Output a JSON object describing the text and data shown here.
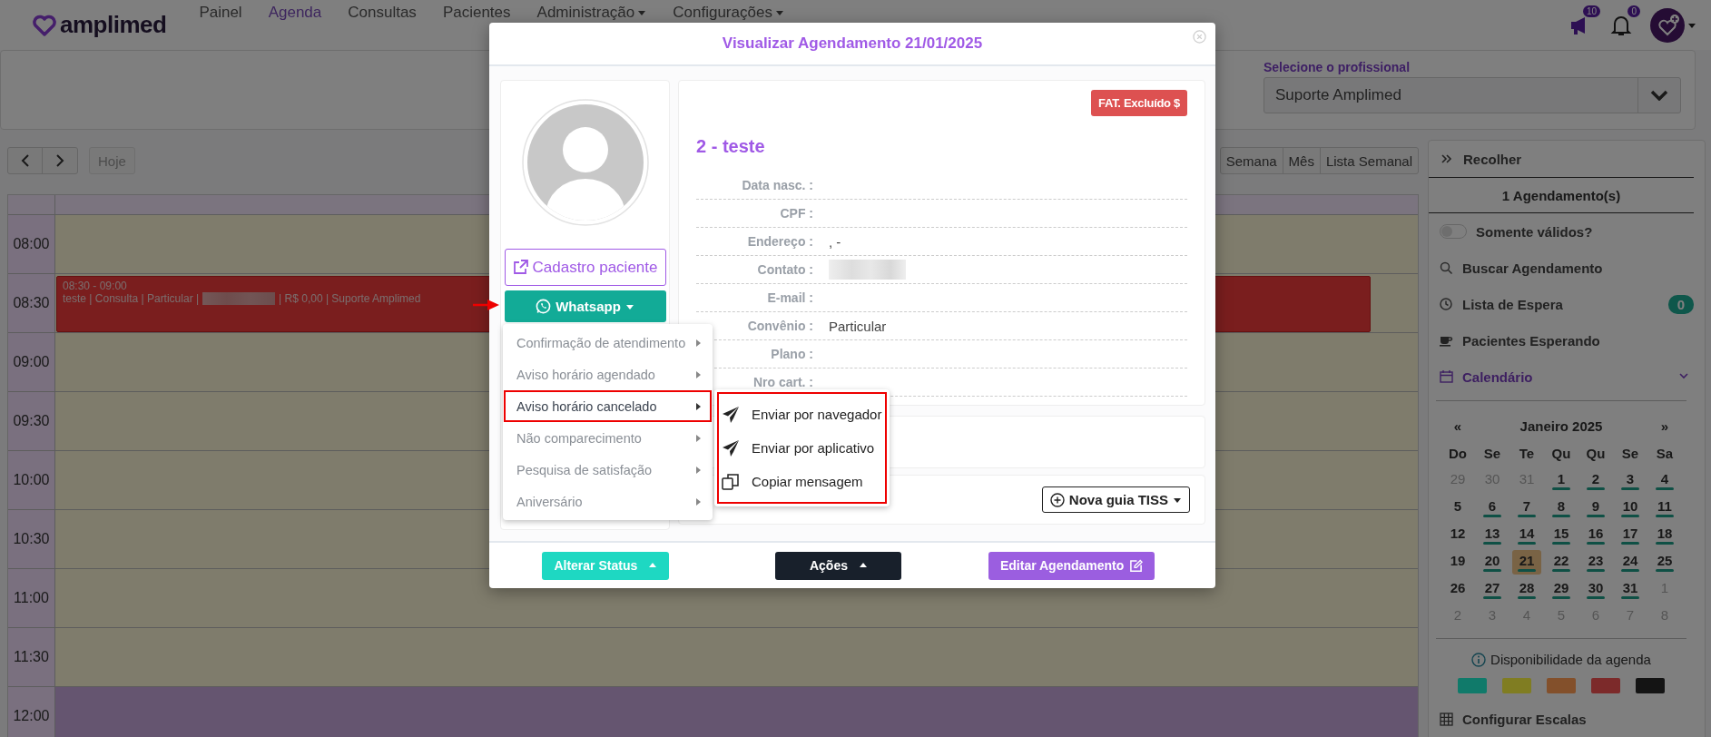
{
  "nav": {
    "logo": "amplimed",
    "items": [
      {
        "label": "Painel",
        "selected": false,
        "dropdown": false
      },
      {
        "label": "Agenda",
        "selected": true,
        "dropdown": false
      },
      {
        "label": "Consultas",
        "selected": false,
        "dropdown": false
      },
      {
        "label": "Pacientes",
        "selected": false,
        "dropdown": false
      },
      {
        "label": "Administração",
        "selected": false,
        "dropdown": true
      },
      {
        "label": "Configurações",
        "selected": false,
        "dropdown": true
      }
    ],
    "announcements_badge": "10",
    "notifications_badge": "0"
  },
  "header": {
    "professional_label": "Selecione o profissional",
    "professional_value": "Suporte Amplimed"
  },
  "toolbar": {
    "today": "Hoje",
    "views": [
      "Semana",
      "Mês",
      "Lista Semanal"
    ]
  },
  "schedule": {
    "slots": [
      {
        "time": "08:00",
        "kind": "open"
      },
      {
        "time": "08:30",
        "kind": "open",
        "events": [
          {
            "time": "08:30 - 09:00",
            "text_before": "teste | Consulta | Particular |",
            "text_after": "| R$ 0,00 | Suporte Amplimed"
          }
        ]
      },
      {
        "time": "09:00",
        "kind": "open"
      },
      {
        "time": "09:30",
        "kind": "open"
      },
      {
        "time": "10:00",
        "kind": "open"
      },
      {
        "time": "10:30",
        "kind": "open"
      },
      {
        "time": "11:00",
        "kind": "open"
      },
      {
        "time": "11:30",
        "kind": "open"
      },
      {
        "time": "12:00",
        "kind": "blocked"
      }
    ]
  },
  "sidebar": {
    "collapse": "Recolher",
    "count": "1 Agendamento(s)",
    "valid_only": {
      "label": "Somente válidos?",
      "on": false
    },
    "links": [
      {
        "kind": "search",
        "label": "Buscar Agendamento"
      },
      {
        "kind": "waitlist",
        "label": "Lista de Espera",
        "badge": "0"
      },
      {
        "kind": "waiting",
        "label": "Pacientes Esperando"
      }
    ],
    "calendar": {
      "label": "Calendário",
      "expanded": true,
      "prev": "«",
      "next": "»",
      "month": "Janeiro 2025",
      "weekdays": [
        "Do",
        "Se",
        "Te",
        "Qu",
        "Qu",
        "Se",
        "Sa"
      ],
      "weeks": [
        [
          {
            "day": "29",
            "other_month": true,
            "has_events": false,
            "selected": false
          },
          {
            "day": "30",
            "other_month": true,
            "has_events": false,
            "selected": false
          },
          {
            "day": "31",
            "other_month": true,
            "has_events": false,
            "selected": false
          },
          {
            "day": "1",
            "other_month": false,
            "has_events": true,
            "selected": false
          },
          {
            "day": "2",
            "other_month": false,
            "has_events": true,
            "selected": false
          },
          {
            "day": "3",
            "other_month": false,
            "has_events": true,
            "selected": false
          },
          {
            "day": "4",
            "other_month": false,
            "has_events": true,
            "selected": false
          }
        ],
        [
          {
            "day": "5",
            "other_month": false,
            "has_events": false,
            "selected": false
          },
          {
            "day": "6",
            "other_month": false,
            "has_events": true,
            "selected": false
          },
          {
            "day": "7",
            "other_month": false,
            "has_events": true,
            "selected": false
          },
          {
            "day": "8",
            "other_month": false,
            "has_events": true,
            "selected": false
          },
          {
            "day": "9",
            "other_month": false,
            "has_events": true,
            "selected": false
          },
          {
            "day": "10",
            "other_month": false,
            "has_events": true,
            "selected": false
          },
          {
            "day": "11",
            "other_month": false,
            "has_events": true,
            "selected": false
          }
        ],
        [
          {
            "day": "12",
            "other_month": false,
            "has_events": false,
            "selected": false
          },
          {
            "day": "13",
            "other_month": false,
            "has_events": true,
            "selected": false
          },
          {
            "day": "14",
            "other_month": false,
            "has_events": true,
            "selected": false
          },
          {
            "day": "15",
            "other_month": false,
            "has_events": true,
            "selected": false
          },
          {
            "day": "16",
            "other_month": false,
            "has_events": true,
            "selected": false
          },
          {
            "day": "17",
            "other_month": false,
            "has_events": true,
            "selected": false
          },
          {
            "day": "18",
            "other_month": false,
            "has_events": true,
            "selected": false
          }
        ],
        [
          {
            "day": "19",
            "other_month": false,
            "has_events": false,
            "selected": false
          },
          {
            "day": "20",
            "other_month": false,
            "has_events": true,
            "selected": false
          },
          {
            "day": "21",
            "other_month": false,
            "has_events": true,
            "selected": true
          },
          {
            "day": "22",
            "other_month": false,
            "has_events": true,
            "selected": false
          },
          {
            "day": "23",
            "other_month": false,
            "has_events": true,
            "selected": false
          },
          {
            "day": "24",
            "other_month": false,
            "has_events": true,
            "selected": false
          },
          {
            "day": "25",
            "other_month": false,
            "has_events": true,
            "selected": false
          }
        ],
        [
          {
            "day": "26",
            "other_month": false,
            "has_events": false,
            "selected": false
          },
          {
            "day": "27",
            "other_month": false,
            "has_events": true,
            "selected": false
          },
          {
            "day": "28",
            "other_month": false,
            "has_events": true,
            "selected": false
          },
          {
            "day": "29",
            "other_month": false,
            "has_events": true,
            "selected": false
          },
          {
            "day": "30",
            "other_month": false,
            "has_events": true,
            "selected": false
          },
          {
            "day": "31",
            "other_month": false,
            "has_events": true,
            "selected": false
          },
          {
            "day": "1",
            "other_month": true,
            "has_events": false,
            "selected": false
          }
        ],
        [
          {
            "day": "2",
            "other_month": true,
            "has_events": false,
            "selected": false
          },
          {
            "day": "3",
            "other_month": true,
            "has_events": false,
            "selected": false
          },
          {
            "day": "4",
            "other_month": true,
            "has_events": false,
            "selected": false
          },
          {
            "day": "5",
            "other_month": true,
            "has_events": false,
            "selected": false
          },
          {
            "day": "6",
            "other_month": true,
            "has_events": false,
            "selected": false
          },
          {
            "day": "7",
            "other_month": true,
            "has_events": false,
            "selected": false
          },
          {
            "day": "8",
            "other_month": true,
            "has_events": false,
            "selected": false
          }
        ]
      ]
    },
    "availability": {
      "label": "Disponibilidade da agenda",
      "colors": [
        {
          "color": "#107a6a"
        },
        {
          "color": "#807d22"
        },
        {
          "color": "#83502b"
        },
        {
          "color": "#7c2a2a"
        },
        {
          "color": "#141414"
        }
      ]
    },
    "configure": "Configurar Escalas"
  },
  "modal": {
    "title": "Visualizar Agendamento 21/01/2025",
    "patient_button": "Cadastro paciente",
    "whatsapp_button": "Whatsapp",
    "whatsapp_menu": [
      {
        "label": "Confirmação de atendimento",
        "selected": false
      },
      {
        "label": "Aviso horário agendado",
        "selected": false
      },
      {
        "label": "Aviso horário cancelado",
        "selected": true
      },
      {
        "label": "Não comparecimento",
        "selected": false
      },
      {
        "label": "Pesquisa de satisfação",
        "selected": false
      },
      {
        "label": "Aniversário",
        "selected": false
      }
    ],
    "submenu": [
      {
        "kind": "send",
        "label": "Enviar por navegador"
      },
      {
        "kind": "send",
        "label": "Enviar por aplicativo"
      },
      {
        "kind": "copy",
        "label": "Copiar mensagem"
      }
    ],
    "badge": "FAT. Excluído $",
    "patient_name": "2 - teste",
    "fields": [
      {
        "label": "Data nasc. :"
      },
      {
        "label": "CPF :"
      },
      {
        "label": "Endereço :",
        "value": ", -"
      },
      {
        "label": "Contato :",
        "redacted": true
      },
      {
        "label": "E-mail :"
      },
      {
        "label": "Convênio :",
        "value": "Particular"
      },
      {
        "label": "Plano :"
      },
      {
        "label": "Nro cart. :"
      }
    ],
    "tiss_button": "Nova guia TISS",
    "footer": {
      "status": "Alterar Status",
      "actions": "Ações",
      "edit": "Editar Agendamento"
    }
  }
}
